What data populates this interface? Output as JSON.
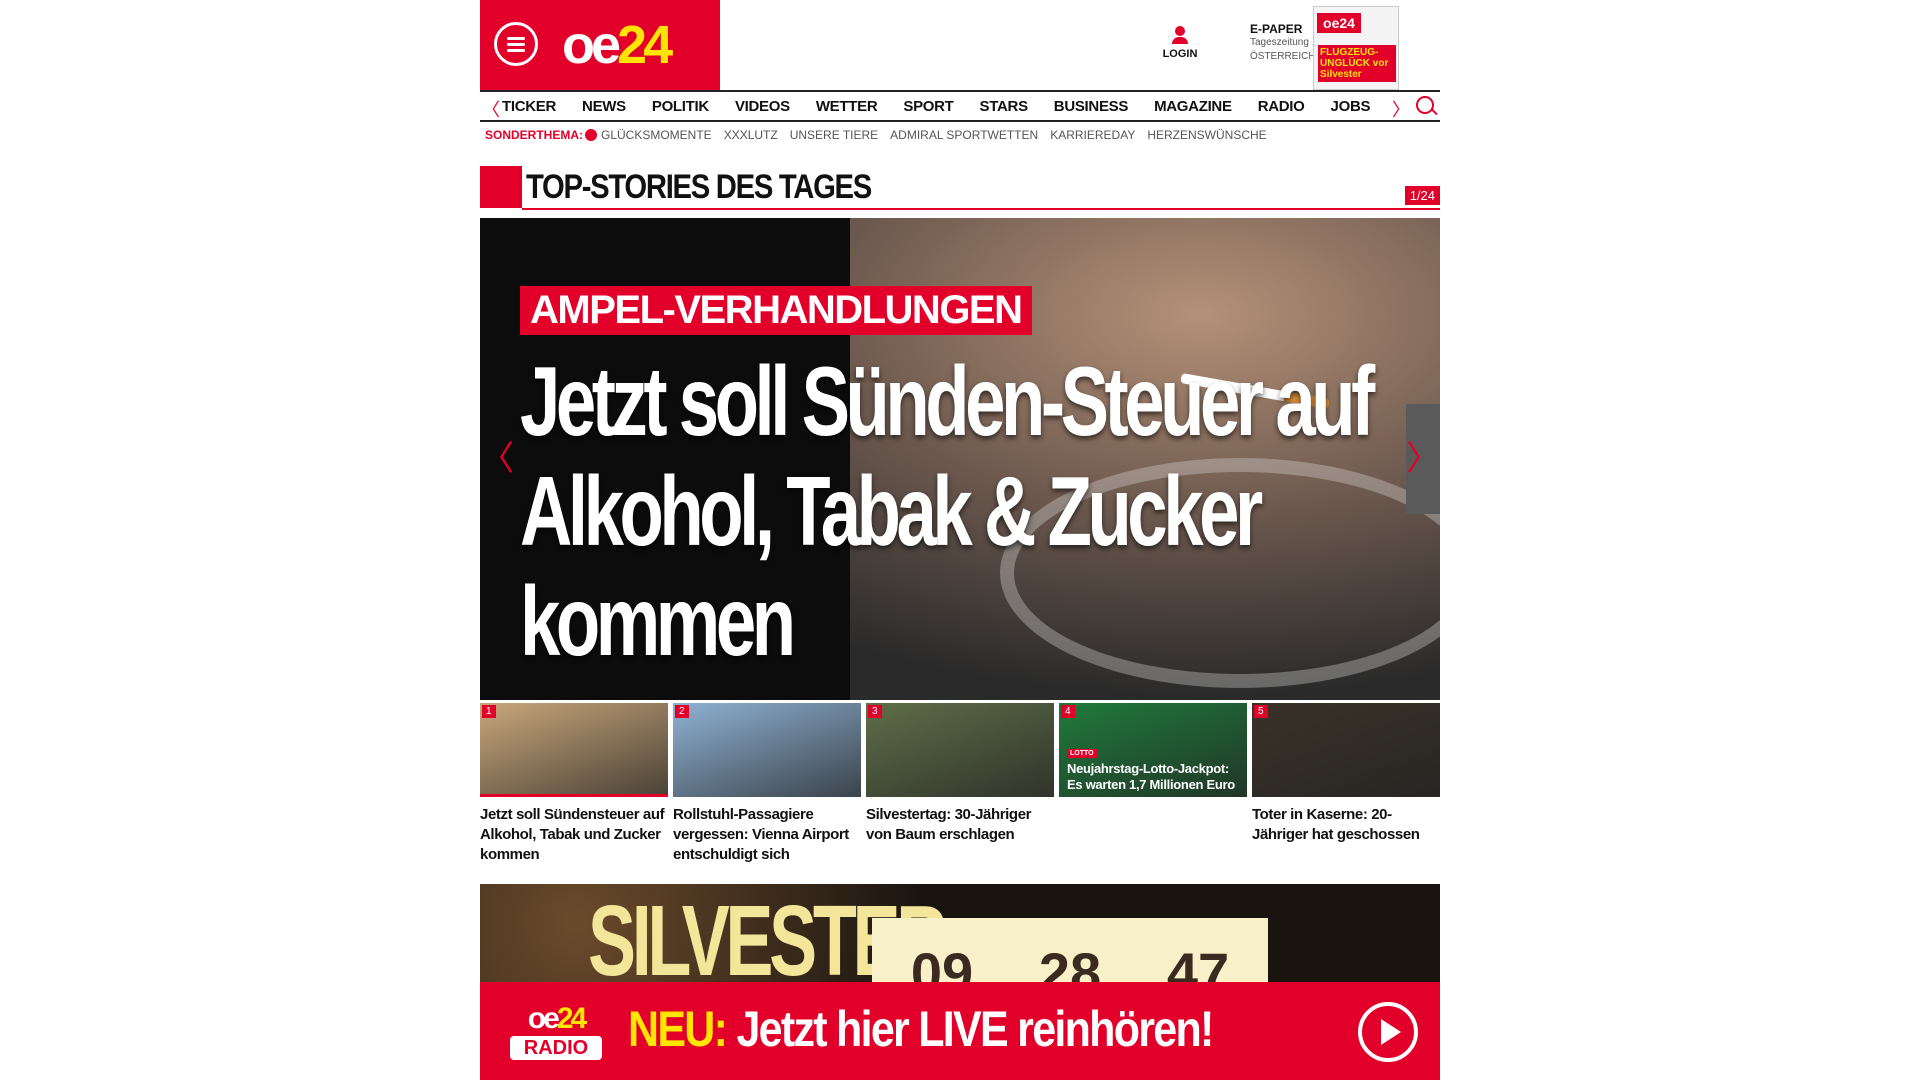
{
  "header": {
    "logo_oe": "oe",
    "logo_num": "24",
    "login_label": "LOGIN",
    "epaper_title": "E-PAPER",
    "epaper_sub1": "Tageszeitung",
    "epaper_sub2": "ÖSTERREICH",
    "cover_logo": "oe24",
    "cover_headline": "FLUGZEUG-UNGLÜCK vor Silvester"
  },
  "nav": {
    "prev": "〈",
    "next": "〉",
    "items": [
      "TICKER",
      "NEWS",
      "POLITIK",
      "VIDEOS",
      "WETTER",
      "SPORT",
      "STARS",
      "BUSINESS",
      "MAGAZINE",
      "RADIO",
      "JOBS"
    ]
  },
  "subnav": {
    "label": "SONDERTHEMA:",
    "items": [
      "GLÜCKSMOMENTE",
      "XXXLUTZ",
      "UNSERE TIERE",
      "ADMIRAL SPORTWETTEN",
      "KARRIEREDAY",
      "HERZENSWÜNSCHE"
    ]
  },
  "section": {
    "title": "TOP-STORIES DES TAGES",
    "counter": "1/24"
  },
  "hero": {
    "kicker": "AMPEL-VERHANDLUNGEN",
    "headline": "Jetzt soll Sünden-Steuer auf Alkohol, Tabak & Zucker kommen",
    "prev": "〈",
    "next": "〉"
  },
  "thumbs": [
    {
      "num": "1",
      "caption": "Jetzt soll Sündensteuer auf Alkohol, Tabak und Zucker kommen",
      "color": "#c9a77a"
    },
    {
      "num": "2",
      "caption": "Rollstuhl-Passagiere vergessen: Vienna Airport entschuldigt sich",
      "color": "#8fb2d4"
    },
    {
      "num": "3",
      "caption": "Silvestertag: 30-Jähriger von Baum erschlagen",
      "color": "#5e6e48"
    },
    {
      "num": "4",
      "caption": "",
      "overlay": "Neujahrstag-Lotto-Jackpot: Es warten 1,7 Millionen Euro",
      "tag": "LOTTO",
      "color": "#1f7a3b"
    },
    {
      "num": "5",
      "caption": "Toter in Kaserne: 20-Jähriger hat geschossen",
      "color": "#3a3228"
    }
  ],
  "silvester": {
    "word": "SILVESTER",
    "hours": "09",
    "minutes": "28",
    "seconds": "47"
  },
  "radio": {
    "logo_oe": "oe",
    "logo_num": "24",
    "logo_radio": "RADIO",
    "neu": "NEU:",
    "message": " Jetzt hier LIVE reinhören!"
  },
  "colors": {
    "brand": "#e2002b",
    "accent": "#ffe500"
  }
}
